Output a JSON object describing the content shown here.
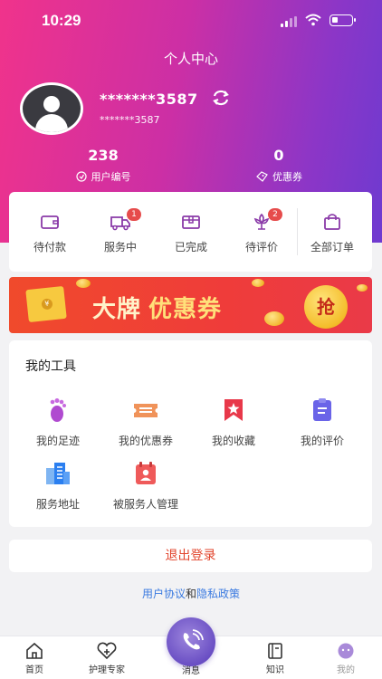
{
  "status_bar": {
    "time": "10:29"
  },
  "header": {
    "title": "个人中心",
    "user_name": "*******3587",
    "user_sub": "*******3587",
    "stats": [
      {
        "value": "238",
        "label": "用户编号",
        "icon": "clock-icon"
      },
      {
        "value": "0",
        "label": "优惠券",
        "icon": "ticket-icon"
      }
    ]
  },
  "orders": {
    "items": [
      {
        "label": "待付款",
        "icon": "wallet-icon",
        "badge": ""
      },
      {
        "label": "服务中",
        "icon": "truck-icon",
        "badge": "1"
      },
      {
        "label": "已完成",
        "icon": "box-icon",
        "badge": ""
      },
      {
        "label": "待评价",
        "icon": "flower-icon",
        "badge": "2"
      },
      {
        "label": "全部订单",
        "icon": "bag-icon",
        "badge": ""
      }
    ]
  },
  "banner": {
    "text_1": "大牌",
    "text_2": "优惠券",
    "grab": "抢"
  },
  "tools": {
    "title": "我的工具",
    "items": [
      {
        "label": "我的足迹",
        "icon": "footprint-icon"
      },
      {
        "label": "我的优惠券",
        "icon": "coupon-icon"
      },
      {
        "label": "我的收藏",
        "icon": "bookmark-star-icon"
      },
      {
        "label": "我的评价",
        "icon": "clipboard-icon"
      },
      {
        "label": "服务地址",
        "icon": "building-icon"
      },
      {
        "label": "被服务人管理",
        "icon": "calendar-person-icon"
      }
    ]
  },
  "logout": "退出登录",
  "agreement": {
    "link_1": "用户协议",
    "conj": "和",
    "link_2": "隐私政策"
  },
  "tabbar": {
    "tabs": [
      {
        "label": "首页",
        "icon": "home-icon"
      },
      {
        "label": "护理专家",
        "icon": "heart-plus-icon"
      },
      {
        "label": "消息",
        "icon": "phone-icon"
      },
      {
        "label": "知识",
        "icon": "book-icon"
      },
      {
        "label": "我的",
        "icon": "face-icon"
      }
    ]
  },
  "colors": {
    "accent_pink": "#f0338b",
    "accent_purple": "#6e3ad0",
    "logout_red": "#e2452d",
    "link_blue": "#3a7ae0"
  }
}
